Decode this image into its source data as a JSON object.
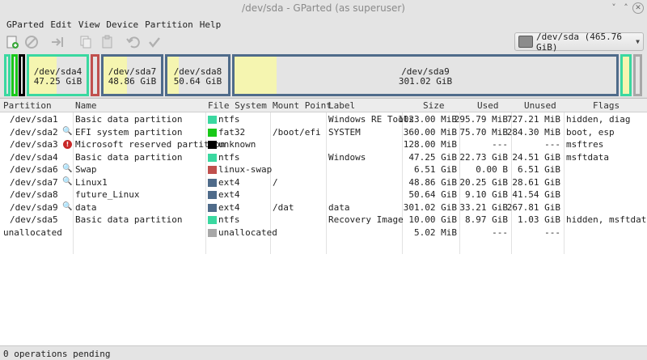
{
  "window": {
    "title": "/dev/sda - GParted (as superuser)"
  },
  "menu": [
    "GParted",
    "Edit",
    "View",
    "Device",
    "Partition",
    "Help"
  ],
  "toolbar": {
    "icons": [
      "new-partition-icon",
      "delete-icon",
      "resize-move-icon",
      "copy-icon",
      "paste-icon",
      "undo-icon",
      "apply-icon"
    ]
  },
  "device_selector": {
    "value": "/dev/sda  (465.76 GiB)"
  },
  "disk_map": {
    "segments": [
      {
        "name": "",
        "size": ""
      },
      {
        "name": "",
        "size": ""
      },
      {
        "name": "",
        "size": ""
      },
      {
        "name": "/dev/sda4",
        "size": "47.25 GiB",
        "color": "#3ad8a0",
        "used_fraction": 0.48
      },
      {
        "name": "",
        "size": ""
      },
      {
        "name": "/dev/sda7",
        "size": "48.86 GiB",
        "color": "#4f6b8a",
        "used_fraction": 0.41
      },
      {
        "name": "/dev/sda8",
        "size": "50.64 GiB",
        "color": "#4f6b8a",
        "used_fraction": 0.18
      },
      {
        "name": "/dev/sda9",
        "size": "301.02 GiB",
        "color": "#4f6b8a",
        "used_fraction": 0.11
      },
      {
        "name": "",
        "size": ""
      }
    ]
  },
  "table": {
    "headers": [
      "Partition",
      "Name",
      "File System",
      "Mount Point",
      "Label",
      "Size",
      "Used",
      "Unused",
      "Flags"
    ],
    "rows": [
      {
        "partition": "/dev/sda1",
        "name": "Basic data partition",
        "fs": "ntfs",
        "fs_color": "#3ad8a0",
        "mount": "",
        "label": "Windows RE Tools",
        "size": "1023.00 MiB",
        "used": "295.79 MiB",
        "unused": "727.21 MiB",
        "flags": "hidden, diag",
        "icon": ""
      },
      {
        "partition": "/dev/sda2",
        "name": "EFI system partition",
        "fs": "fat32",
        "fs_color": "#18c818",
        "mount": "/boot/efi",
        "label": "SYSTEM",
        "size": "360.00 MiB",
        "used": "75.70 MiB",
        "unused": "284.30 MiB",
        "flags": "boot, esp",
        "icon": "key-icon"
      },
      {
        "partition": "/dev/sda3",
        "name": "Microsoft reserved partition",
        "fs": "unknown",
        "fs_color": "#000000",
        "mount": "",
        "label": "",
        "size": "128.00 MiB",
        "used": "---",
        "unused": "---",
        "flags": "msftres",
        "icon": "warning-icon"
      },
      {
        "partition": "/dev/sda4",
        "name": "Basic data partition",
        "fs": "ntfs",
        "fs_color": "#3ad8a0",
        "mount": "",
        "label": "Windows",
        "size": "47.25 GiB",
        "used": "22.73 GiB",
        "unused": "24.51 GiB",
        "flags": "msftdata",
        "icon": ""
      },
      {
        "partition": "/dev/sda6",
        "name": "Swap",
        "fs": "linux-swap",
        "fs_color": "#c0504d",
        "mount": "",
        "label": "",
        "size": "6.51 GiB",
        "used": "0.00 B",
        "unused": "6.51 GiB",
        "flags": "",
        "icon": "key-icon"
      },
      {
        "partition": "/dev/sda7",
        "name": "Linux1",
        "fs": "ext4",
        "fs_color": "#4f6b8a",
        "mount": "/",
        "label": "",
        "size": "48.86 GiB",
        "used": "20.25 GiB",
        "unused": "28.61 GiB",
        "flags": "",
        "icon": "key-icon"
      },
      {
        "partition": "/dev/sda8",
        "name": "future_Linux",
        "fs": "ext4",
        "fs_color": "#4f6b8a",
        "mount": "",
        "label": "",
        "size": "50.64 GiB",
        "used": "9.10 GiB",
        "unused": "41.54 GiB",
        "flags": "",
        "icon": ""
      },
      {
        "partition": "/dev/sda9",
        "name": "data",
        "fs": "ext4",
        "fs_color": "#4f6b8a",
        "mount": "/dat",
        "label": "data",
        "size": "301.02 GiB",
        "used": "33.21 GiB",
        "unused": "267.81 GiB",
        "flags": "",
        "icon": "key-icon"
      },
      {
        "partition": "/dev/sda5",
        "name": "Basic data partition",
        "fs": "ntfs",
        "fs_color": "#3ad8a0",
        "mount": "",
        "label": "Recovery Image",
        "size": "10.00 GiB",
        "used": "8.97 GiB",
        "unused": "1.03 GiB",
        "flags": "hidden, msftdata",
        "icon": ""
      },
      {
        "partition": "unallocated",
        "name": "",
        "fs": "unallocated",
        "fs_color": "#a8a8a8",
        "mount": "",
        "label": "",
        "size": "5.02 MiB",
        "used": "---",
        "unused": "---",
        "flags": "",
        "icon": ""
      }
    ]
  },
  "status": {
    "text": "0 operations pending"
  }
}
